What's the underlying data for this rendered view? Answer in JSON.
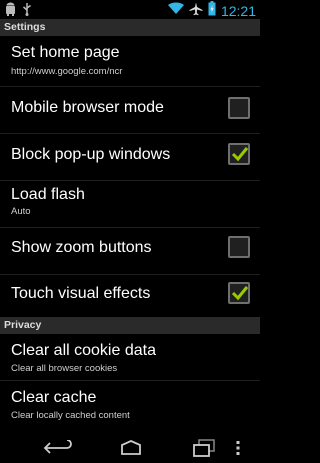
{
  "status_bar": {
    "time": "12:21",
    "icons": [
      "android-icon",
      "usb-icon",
      "wifi-icon",
      "airplane-icon",
      "battery-icon"
    ]
  },
  "title": "Settings",
  "settings": [
    {
      "title": "Set home page",
      "summary": "http://www.google.com/ncr"
    },
    {
      "title": "Mobile browser mode",
      "checked": false
    },
    {
      "title": "Block pop-up windows",
      "checked": true
    },
    {
      "title": "Load flash",
      "summary": "Auto"
    },
    {
      "title": "Show zoom buttons",
      "checked": false
    },
    {
      "title": "Touch visual effects",
      "checked": true
    }
  ],
  "privacy_header": "Privacy",
  "privacy": [
    {
      "title": "Clear all cookie data",
      "summary": "Clear all browser cookies"
    },
    {
      "title": "Clear cache",
      "summary": "Clear locally cached content"
    }
  ],
  "nav_bar": {
    "icons": [
      "back-icon",
      "home-icon",
      "recent-apps-icon",
      "overflow-menu-icon"
    ]
  },
  "colors": {
    "accent": "#33b5e5",
    "checkmark": "#99cc00"
  }
}
